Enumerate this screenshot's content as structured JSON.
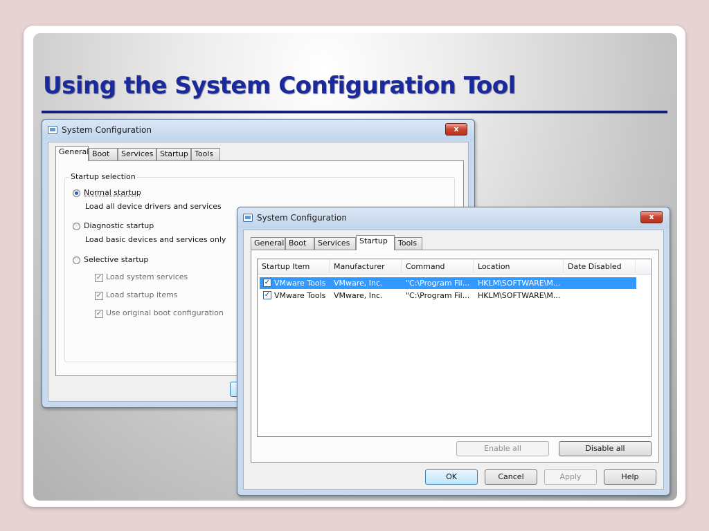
{
  "slide": {
    "title": "Using the System Configuration Tool"
  },
  "back_window": {
    "title": "System Configuration",
    "close_label": "x",
    "tabs": [
      "General",
      "Boot",
      "Services",
      "Startup",
      "Tools"
    ],
    "active_tab": "General",
    "group_label": "Startup selection",
    "options": [
      {
        "label": "Normal startup",
        "description": "Load all device drivers and services",
        "selected": true
      },
      {
        "label": "Diagnostic startup",
        "description": "Load basic devices and services only",
        "selected": false
      },
      {
        "label": "Selective startup",
        "description": "",
        "selected": false
      }
    ],
    "selective_items": [
      {
        "label": "Load system services",
        "checked": true
      },
      {
        "label": "Load startup items",
        "checked": true
      },
      {
        "label": "Use original boot configuration",
        "checked": true
      }
    ]
  },
  "front_window": {
    "title": "System Configuration",
    "close_label": "x",
    "tabs": [
      "General",
      "Boot",
      "Services",
      "Startup",
      "Tools"
    ],
    "active_tab": "Startup",
    "columns": [
      "Startup Item",
      "Manufacturer",
      "Command",
      "Location",
      "Date Disabled"
    ],
    "rows": [
      {
        "checked": true,
        "item": "VMware Tools",
        "manufacturer": "VMware, Inc.",
        "command": "\"C:\\Program Fil...",
        "location": "HKLM\\SOFTWARE\\M...",
        "date_disabled": "",
        "selected": true
      },
      {
        "checked": true,
        "item": "VMware Tools",
        "manufacturer": "VMware, Inc.",
        "command": "\"C:\\Program Fil...",
        "location": "HKLM\\SOFTWARE\\M...",
        "date_disabled": "",
        "selected": false
      }
    ],
    "enable_all_label": "Enable all",
    "disable_all_label": "Disable all",
    "ok_label": "OK",
    "cancel_label": "Cancel",
    "apply_label": "Apply",
    "help_label": "Help"
  },
  "colors": {
    "title_blue": "#1a2a9c",
    "selection_blue": "#3399ff",
    "close_red": "#c8432f"
  }
}
